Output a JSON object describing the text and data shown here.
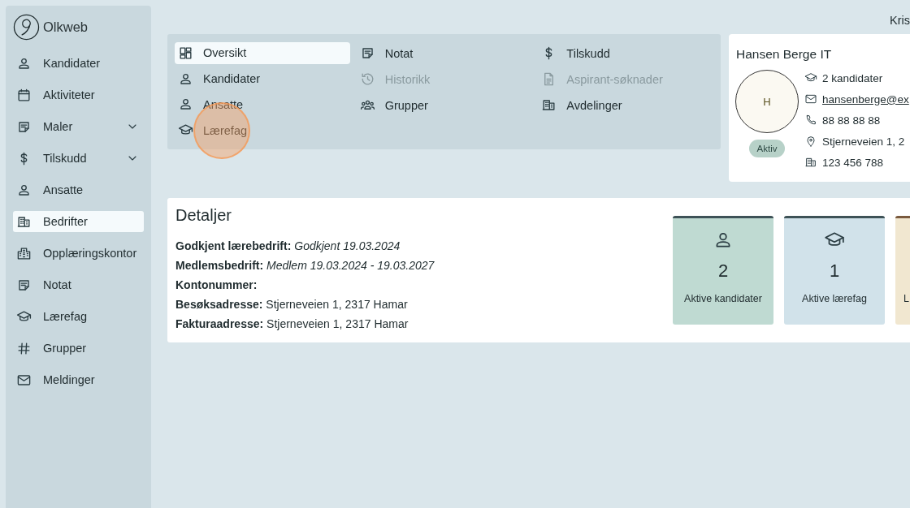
{
  "app": {
    "name": "Olkweb"
  },
  "sidebar": {
    "items": [
      {
        "label": "Kandidater",
        "kind": "link",
        "selected": false
      },
      {
        "label": "Aktiviteter",
        "kind": "link",
        "selected": false
      },
      {
        "label": "Maler",
        "kind": "group",
        "expanded": false,
        "selected": false
      },
      {
        "label": "Tilskudd",
        "kind": "group",
        "expanded": false,
        "selected": false
      },
      {
        "label": "Ansatte",
        "kind": "link",
        "selected": false
      },
      {
        "label": "Bedrifter",
        "kind": "link",
        "selected": true
      },
      {
        "label": "Opplæringskontor",
        "kind": "link",
        "selected": false
      },
      {
        "label": "Notat",
        "kind": "link",
        "selected": false
      },
      {
        "label": "Lærefag",
        "kind": "link",
        "selected": false
      },
      {
        "label": "Grupper",
        "kind": "link",
        "selected": false
      },
      {
        "label": "Meldinger",
        "kind": "link",
        "selected": false
      }
    ]
  },
  "user": {
    "name": "Kris"
  },
  "tabs": {
    "columns": [
      [
        {
          "label": "Oversikt",
          "selected": true,
          "disabled": false,
          "highlighted": false
        },
        {
          "label": "Kandidater",
          "selected": false,
          "disabled": false,
          "highlighted": false
        },
        {
          "label": "Ansatte",
          "selected": false,
          "disabled": false,
          "highlighted": false
        },
        {
          "label": "Lærefag",
          "selected": false,
          "disabled": false,
          "highlighted": true
        }
      ],
      [
        {
          "label": "Notat",
          "selected": false,
          "disabled": false,
          "highlighted": false
        },
        {
          "label": "Historikk",
          "selected": false,
          "disabled": true,
          "highlighted": false
        },
        {
          "label": "Grupper",
          "selected": false,
          "disabled": false,
          "highlighted": false
        }
      ],
      [
        {
          "label": "Tilskudd",
          "selected": false,
          "disabled": false,
          "highlighted": false
        },
        {
          "label": "Aspirant-søknader",
          "selected": false,
          "disabled": true,
          "highlighted": false
        },
        {
          "label": "Avdelinger",
          "selected": false,
          "disabled": false,
          "highlighted": false
        }
      ]
    ]
  },
  "company": {
    "name": "Hansen Berge IT",
    "avatar_letter": "H",
    "status": "Aktiv",
    "facts": [
      {
        "kind": "candidates",
        "text": "2 kandidater"
      },
      {
        "kind": "email",
        "text": "hansenberge@ex"
      },
      {
        "kind": "phone",
        "text": "88 88 88 88"
      },
      {
        "kind": "address",
        "text": "Stjerneveien 1, 2"
      },
      {
        "kind": "orgnr",
        "text": "123 456 788"
      }
    ]
  },
  "details": {
    "title": "Detaljer",
    "lines": [
      "**Godkjent lærebedrift:** *Godkjent 19.03.2024*",
      "**Medlemsbedrift:** *Medlem 19.03.2024 - 19.03.2027*",
      "**Kontonummer:**",
      "**Besøksadresse:** Stjerneveien 1, 2317 Hamar",
      "**Fakturaadresse:** Stjerneveien 1, 2317 Hamar"
    ]
  },
  "stats": [
    {
      "kind": "person",
      "value": "2",
      "label": "Aktive kandidater",
      "color": "#bfdad2"
    },
    {
      "kind": "cap",
      "value": "1",
      "label": "Aktive lærefag",
      "color": "#d1e2ea"
    },
    {
      "kind": "none",
      "label": "L",
      "color": "#f1e7d0"
    }
  ]
}
